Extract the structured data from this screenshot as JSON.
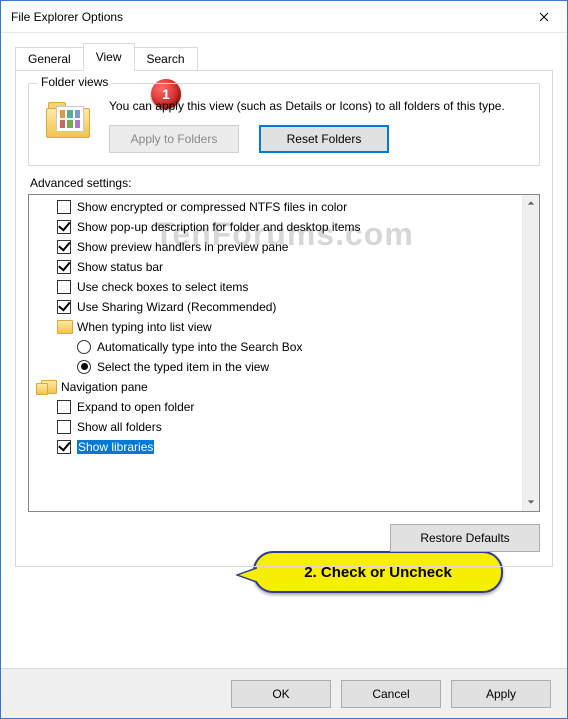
{
  "window": {
    "title": "File Explorer Options"
  },
  "tabs": {
    "general": "General",
    "view": "View",
    "search": "Search",
    "active": "View"
  },
  "folderViews": {
    "groupTitle": "Folder views",
    "description": "You can apply this view (such as Details or Icons) to all folders of this type.",
    "applyBtn": "Apply to Folders",
    "resetBtn": "Reset Folders"
  },
  "advanced": {
    "label": "Advanced settings:",
    "items": [
      {
        "kind": "check",
        "indent": 1,
        "checked": false,
        "label": "Show encrypted or compressed NTFS files in color"
      },
      {
        "kind": "check",
        "indent": 1,
        "checked": true,
        "label": "Show pop-up description for folder and desktop items"
      },
      {
        "kind": "check",
        "indent": 1,
        "checked": true,
        "label": "Show preview handlers in preview pane"
      },
      {
        "kind": "check",
        "indent": 1,
        "checked": true,
        "label": "Show status bar"
      },
      {
        "kind": "check",
        "indent": 1,
        "checked": false,
        "label": "Use check boxes to select items"
      },
      {
        "kind": "check",
        "indent": 1,
        "checked": true,
        "label": "Use Sharing Wizard (Recommended)"
      },
      {
        "kind": "group",
        "indent": 1,
        "icon": "folder",
        "label": "When typing into list view"
      },
      {
        "kind": "radio",
        "indent": 2,
        "selected": false,
        "label": "Automatically type into the Search Box"
      },
      {
        "kind": "radio",
        "indent": 2,
        "selected": true,
        "label": "Select the typed item in the view"
      },
      {
        "kind": "group",
        "indent": 0,
        "icon": "nav",
        "label": "Navigation pane"
      },
      {
        "kind": "check",
        "indent": 1,
        "checked": false,
        "label": "Expand to open folder"
      },
      {
        "kind": "check",
        "indent": 1,
        "checked": false,
        "label": "Show all folders"
      },
      {
        "kind": "check",
        "indent": 1,
        "checked": true,
        "label": "Show libraries",
        "selected": true
      }
    ],
    "restoreBtn": "Restore Defaults"
  },
  "buttons": {
    "ok": "OK",
    "cancel": "Cancel",
    "apply": "Apply"
  },
  "annotations": {
    "step1": "1",
    "step2": "2. Check or Uncheck"
  },
  "watermark": "TenForums.com"
}
